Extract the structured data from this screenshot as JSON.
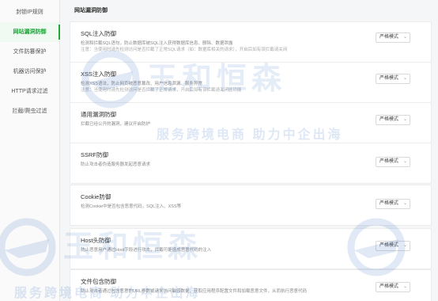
{
  "sidebar": {
    "items": [
      {
        "label": "封锁IP规则",
        "active": false
      },
      {
        "label": "网站漏洞防御",
        "active": true
      },
      {
        "label": "文件防篡保护",
        "active": false
      },
      {
        "label": "机器访问保护",
        "active": false
      },
      {
        "label": "HTTP请求过滤",
        "active": false
      },
      {
        "label": "拦截/爬虫过滤",
        "active": false
      }
    ]
  },
  "main": {
    "section_title": "网站漏洞防御",
    "cards": [
      {
        "title": "SQL注入防御",
        "desc": "检测和拦截SQL语句，防止数据库被SQL注入获得数据库信息、删除、数据泄露",
        "desc2": "注意：当使用时请先检测访问是否拦截了正常SQL请求（如：数据库相关的请求），开启后如有误拦截请关闭",
        "mode": "严格模式"
      },
      {
        "title": "XSS注入防御",
        "desc": "检测XSS语法，防止网页被恶意篡改、用户信息泄漏、服务异常",
        "desc2": "注意：当使用时请先检测访问是否拦截了正常请求，开启后如有误拦截请关闭此功能",
        "mode": "严格模式"
      },
      {
        "title": "通用漏洞防御",
        "desc": "拦截已经公开的漏洞，建议开启防护",
        "desc2": "",
        "mode": "严格模式"
      },
      {
        "title": "SSRF防御",
        "desc": "防止攻击者伪造服务器发起恶意请求",
        "desc2": "",
        "mode": "严格模式"
      },
      {
        "title": "Cookie防御",
        "desc": "检测Cookie中是否包含恶意代码，SQL注入、XSS等",
        "desc2": "",
        "mode": "严格模式"
      },
      {
        "title": "Host头防御",
        "desc": "防止恶意用户通过Host字段进行攻击，拦截可能造成恶意代码的注入",
        "desc2": "",
        "mode": "严格模式"
      },
      {
        "title": "文件包含防御",
        "desc": "防止攻击者通过包含恶意的URL参数或请求访问敏感数据、获取应用程序配置文件和加载恶意文件，从而执行恶意代码",
        "desc2": "",
        "mode": "严格模式"
      }
    ]
  },
  "watermark": {
    "brand": "玉和恒森",
    "slogan": "服务跨境电商 助力中企出海",
    "color": "#2e6cbe"
  }
}
